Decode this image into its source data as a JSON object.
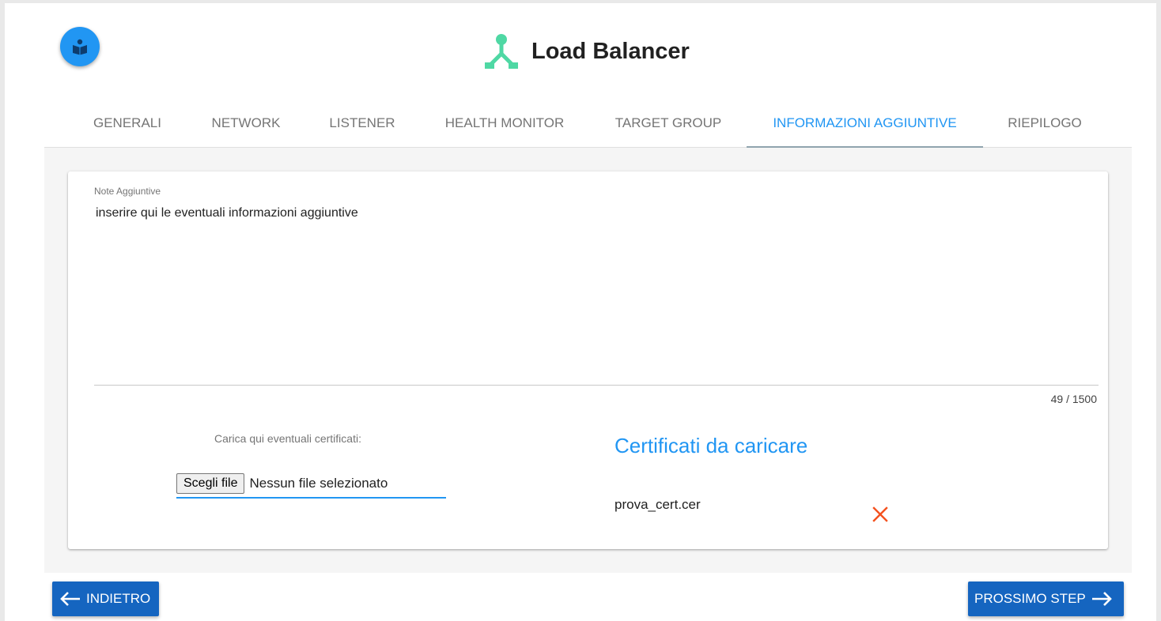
{
  "header": {
    "title": "Load Balancer",
    "icon": "load-balancer-icon",
    "accent": "#4fd8a4"
  },
  "help_button": {
    "icon": "book-reader-icon"
  },
  "tabs": [
    {
      "label": "GENERALI",
      "active": false
    },
    {
      "label": "NETWORK",
      "active": false
    },
    {
      "label": "LISTENER",
      "active": false
    },
    {
      "label": "HEALTH MONITOR",
      "active": false
    },
    {
      "label": "TARGET GROUP",
      "active": false
    },
    {
      "label": "INFORMAZIONI AGGIUNTIVE",
      "active": true
    },
    {
      "label": "RIEPILOGO",
      "active": false
    }
  ],
  "notes": {
    "label": "Note Aggiuntive",
    "value": "inserire qui le eventuali informazioni aggiuntive",
    "counter": "49 / 1500"
  },
  "upload": {
    "label": "Carica qui eventuali certificati:",
    "button_label": "Scegli file",
    "status": "Nessun file selezionato"
  },
  "certificates": {
    "title": "Certificati da caricare",
    "items": [
      {
        "name": "prova_cert.cer",
        "remove_icon": "close-icon"
      }
    ]
  },
  "footer": {
    "back_label": "INDIETRO",
    "next_label": "PROSSIMO STEP"
  },
  "colors": {
    "primary": "#2196f3",
    "button": "#1565c0",
    "remove": "#f4511e"
  }
}
